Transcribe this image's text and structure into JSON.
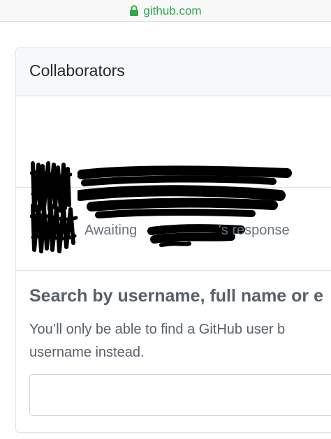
{
  "browser": {
    "url": "github.com",
    "secure_icon": "lock-icon",
    "accent_color": "#2fa84a"
  },
  "collaborators": {
    "title": "Collaborators",
    "pending": {
      "status_prefix": "Awaiting",
      "status_suffix": "'s response"
    }
  },
  "search": {
    "heading": "Search by username, full name or e",
    "description_line1": "You’ll only be able to find a GitHub user b",
    "description_line2": "username instead.",
    "input_value": ""
  }
}
